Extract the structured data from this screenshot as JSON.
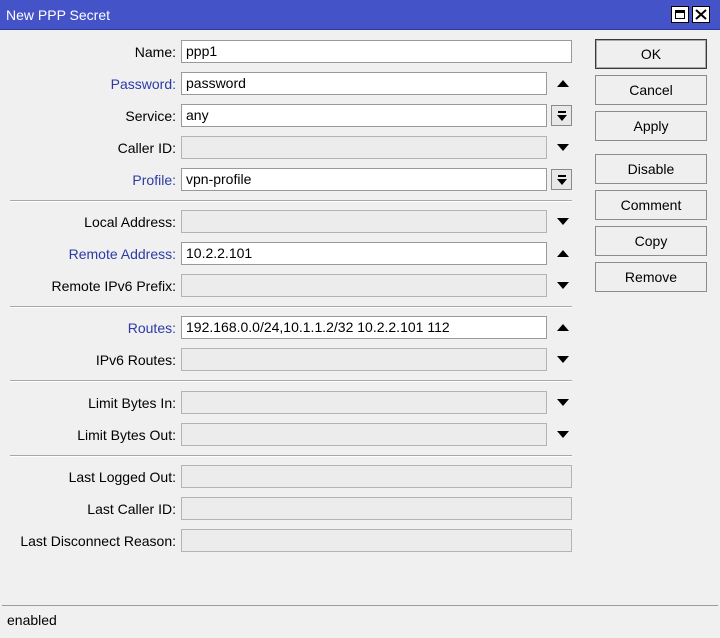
{
  "window": {
    "title": "New PPP Secret"
  },
  "fields": {
    "name": {
      "label": "Name:",
      "value": "ppp1"
    },
    "password": {
      "label": "Password:",
      "value": "password"
    },
    "service": {
      "label": "Service:",
      "value": "any"
    },
    "caller_id": {
      "label": "Caller ID:",
      "value": ""
    },
    "profile": {
      "label": "Profile:",
      "value": "vpn-profile"
    },
    "local_address": {
      "label": "Local Address:",
      "value": ""
    },
    "remote_address": {
      "label": "Remote Address:",
      "value": "10.2.2.101"
    },
    "remote_ipv6_prefix": {
      "label": "Remote IPv6 Prefix:",
      "value": ""
    },
    "routes": {
      "label": "Routes:",
      "value": "192.168.0.0/24,10.1.1.2/32 10.2.2.101 112"
    },
    "ipv6_routes": {
      "label": "IPv6 Routes:",
      "value": ""
    },
    "limit_bytes_in": {
      "label": "Limit Bytes In:",
      "value": ""
    },
    "limit_bytes_out": {
      "label": "Limit Bytes Out:",
      "value": ""
    },
    "last_logged_out": {
      "label": "Last Logged Out:",
      "value": ""
    },
    "last_caller_id": {
      "label": "Last Caller ID:",
      "value": ""
    },
    "last_disconnect_reason": {
      "label": "Last Disconnect Reason:",
      "value": ""
    }
  },
  "buttons": {
    "ok": "OK",
    "cancel": "Cancel",
    "apply": "Apply",
    "disable": "Disable",
    "comment": "Comment",
    "copy": "Copy",
    "remove": "Remove"
  },
  "status": {
    "text": "enabled"
  },
  "icons": {
    "maximize": "maximize-icon",
    "close": "close-icon",
    "collapse": "triangle-up-icon",
    "expand": "triangle-down-icon",
    "dropdown": "dropdown-arrow-icon"
  },
  "colors": {
    "titlebar": "#4454c8",
    "label_blue": "#2d3aa6",
    "window_bg": "#f0f0f0"
  }
}
